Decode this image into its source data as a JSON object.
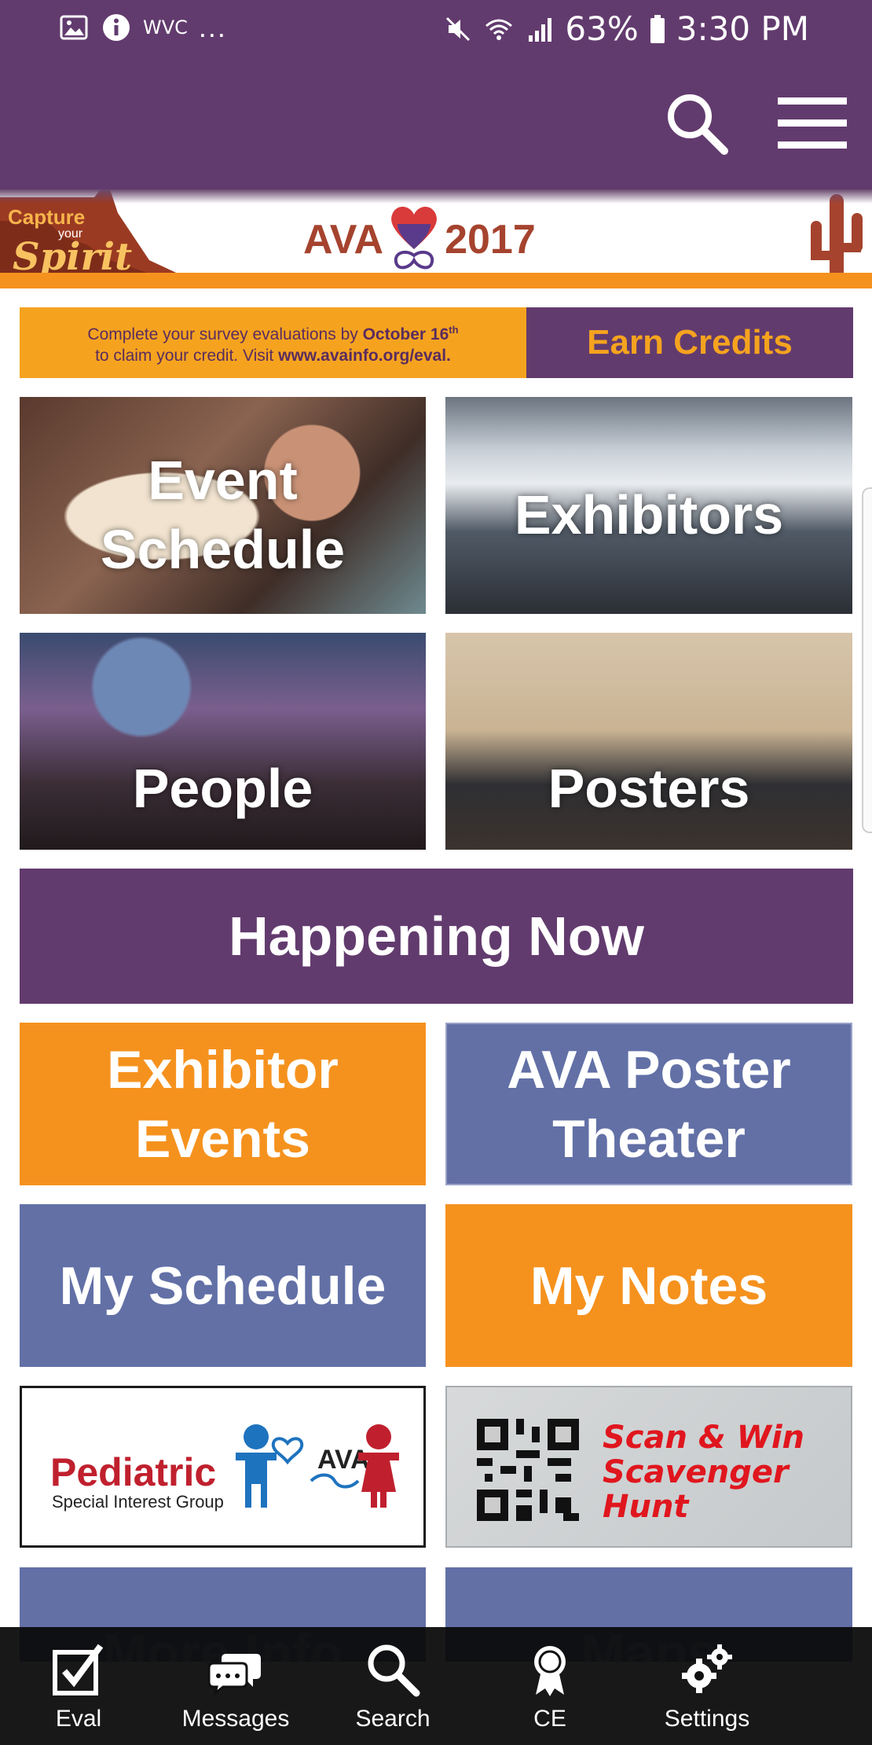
{
  "status_bar": {
    "left_text": "WVC",
    "left_more": "...",
    "battery": "63%",
    "time": "3:30 PM"
  },
  "app_bar": {
    "search_icon": "search-icon",
    "menu_icon": "hamburger-menu-icon"
  },
  "banner": {
    "capture": "Capture",
    "your": "your",
    "spirit": "Spirit",
    "logo_left": "AVA",
    "logo_right": "2017"
  },
  "credits": {
    "line1_prefix": "Complete your survey evaluations by ",
    "line1_date": "October 16",
    "line1_sup": "th",
    "line2_prefix": "to claim your credit. Visit ",
    "line2_url": "www.avainfo.org/eval.",
    "button": "Earn Credits"
  },
  "tiles": {
    "event_schedule": {
      "line1": "Event",
      "line2": "Schedule"
    },
    "exhibitors": "Exhibitors",
    "people": "People",
    "posters": "Posters"
  },
  "buttons": {
    "happening_now": "Happening Now",
    "exhibitor_events": {
      "line1": "Exhibitor",
      "line2": "Events"
    },
    "poster_theater": {
      "line1": "AVA Poster",
      "line2": "Theater"
    },
    "my_schedule": "My Schedule",
    "my_notes": "My Notes"
  },
  "pediatric": {
    "title": "Pediatric",
    "subtitle": "Special Interest Group",
    "logo_text": "AVA"
  },
  "scan": {
    "line1": "Scan & Win",
    "line2": "Scavenger",
    "line3": "Hunt"
  },
  "partial_tiles": {
    "more_info": "More Info",
    "maps": "Maps"
  },
  "bottom_nav": [
    {
      "label": "Eval",
      "icon": "checkbox-icon"
    },
    {
      "label": "Messages",
      "icon": "chat-bubbles-icon"
    },
    {
      "label": "Search",
      "icon": "search-icon"
    },
    {
      "label": "CE",
      "icon": "award-ribbon-icon"
    },
    {
      "label": "Settings",
      "icon": "gears-icon"
    }
  ],
  "colors": {
    "primary_purple": "#623b6e",
    "orange": "#f5921e",
    "blue": "#6270a6",
    "red": "#e0161e"
  }
}
